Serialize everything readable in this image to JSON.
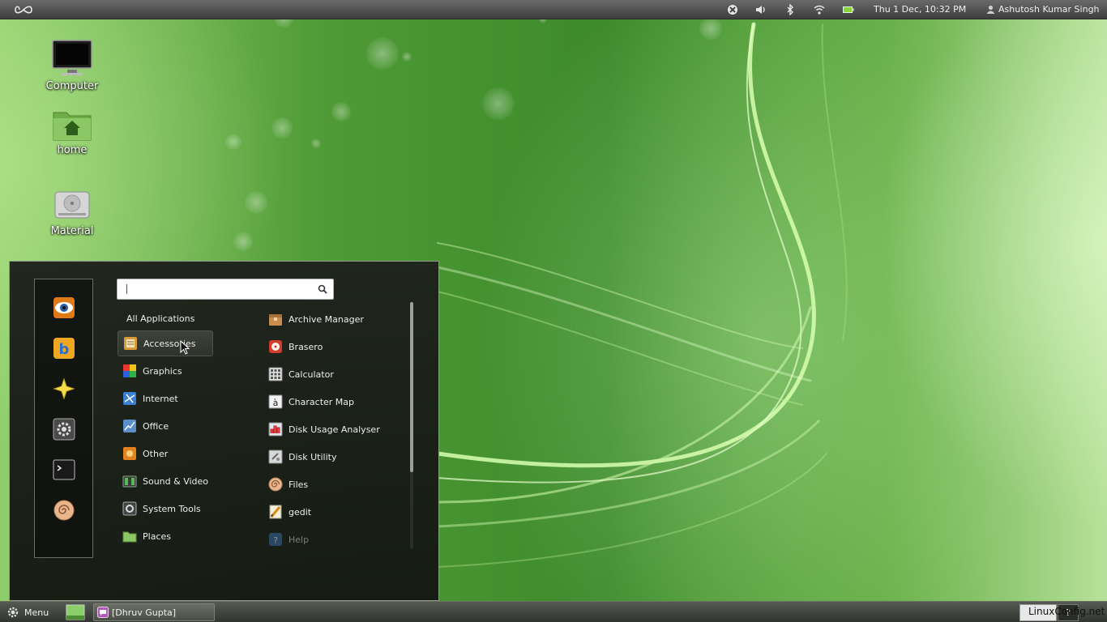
{
  "top_panel": {
    "logo_icon": "infinity-logo-icon",
    "tray_icons": [
      "accessibility-icon",
      "volume-icon",
      "bluetooth-icon",
      "wifi-icon",
      "battery-icon"
    ],
    "clock": "Thu  1 Dec, 10:32 PM",
    "user": "Ashutosh Kumar Singh"
  },
  "desktop": {
    "icons": [
      {
        "label": "Computer",
        "icon": "monitor-icon"
      },
      {
        "label": "home",
        "icon": "home-folder-icon"
      },
      {
        "label": "Material",
        "icon": "drive-icon"
      }
    ]
  },
  "menu": {
    "search": {
      "value": "",
      "placeholder": ""
    },
    "favorites": [
      "eye-app-icon",
      "bitcoin-app-icon",
      "star-app-icon",
      "settings-app-icon",
      "terminal-app-icon",
      "files-app-icon"
    ],
    "all_applications": "All Applications",
    "categories": [
      {
        "label": "Accessories",
        "icon": "accessories-icon"
      },
      {
        "label": "Graphics",
        "icon": "graphics-icon"
      },
      {
        "label": "Internet",
        "icon": "internet-icon"
      },
      {
        "label": "Office",
        "icon": "office-icon"
      },
      {
        "label": "Other",
        "icon": "other-icon"
      },
      {
        "label": "Sound & Video",
        "icon": "sound-video-icon"
      },
      {
        "label": "System Tools",
        "icon": "system-tools-icon"
      },
      {
        "label": "Places",
        "icon": "places-folder-icon"
      }
    ],
    "selected_category": "Accessories",
    "apps": [
      {
        "label": "Archive Manager",
        "icon": "archive-icon"
      },
      {
        "label": "Brasero",
        "icon": "brasero-icon"
      },
      {
        "label": "Calculator",
        "icon": "calculator-icon"
      },
      {
        "label": "Character Map",
        "icon": "character-map-icon"
      },
      {
        "label": "Disk Usage Analyser",
        "icon": "disk-usage-icon"
      },
      {
        "label": "Disk Utility",
        "icon": "disk-utility-icon"
      },
      {
        "label": "Files",
        "icon": "files-icon"
      },
      {
        "label": "gedit",
        "icon": "gedit-icon"
      },
      {
        "label": "Help",
        "icon": "help-icon"
      }
    ]
  },
  "bottom_panel": {
    "menu_label": "Menu",
    "window_label": "[Dhruv Gupta]",
    "watermark": "LinuxConfig.net",
    "workspace_label": "?"
  }
}
